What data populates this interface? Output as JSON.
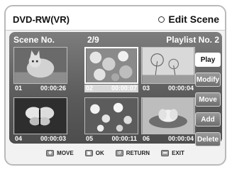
{
  "header": {
    "mode": "DVD-RW(VR)",
    "title": "Edit Scene"
  },
  "info": {
    "scene_label": "Scene No.",
    "page": "2/9",
    "playlist": "Playlist No. 2"
  },
  "scenes": [
    {
      "num": "01",
      "time": "00:00:26",
      "image": "cat-icon",
      "selected": false
    },
    {
      "num": "02",
      "time": "00:00:07",
      "image": "flowers-icon",
      "selected": true
    },
    {
      "num": "03",
      "time": "00:00:04",
      "image": "dandelion-icon",
      "selected": false
    },
    {
      "num": "04",
      "time": "00:00:03",
      "image": "butterfly-icon",
      "selected": false
    },
    {
      "num": "05",
      "time": "00:00:11",
      "image": "blossoms-icon",
      "selected": false
    },
    {
      "num": "06",
      "time": "00:00:04",
      "image": "lotus-icon",
      "selected": false
    }
  ],
  "buttons": [
    "Play",
    "Modify",
    "Move",
    "Add",
    "Delete"
  ],
  "footer": {
    "move": "MOVE",
    "ok": "OK",
    "return": "RETURN",
    "exit": "EXIT"
  }
}
